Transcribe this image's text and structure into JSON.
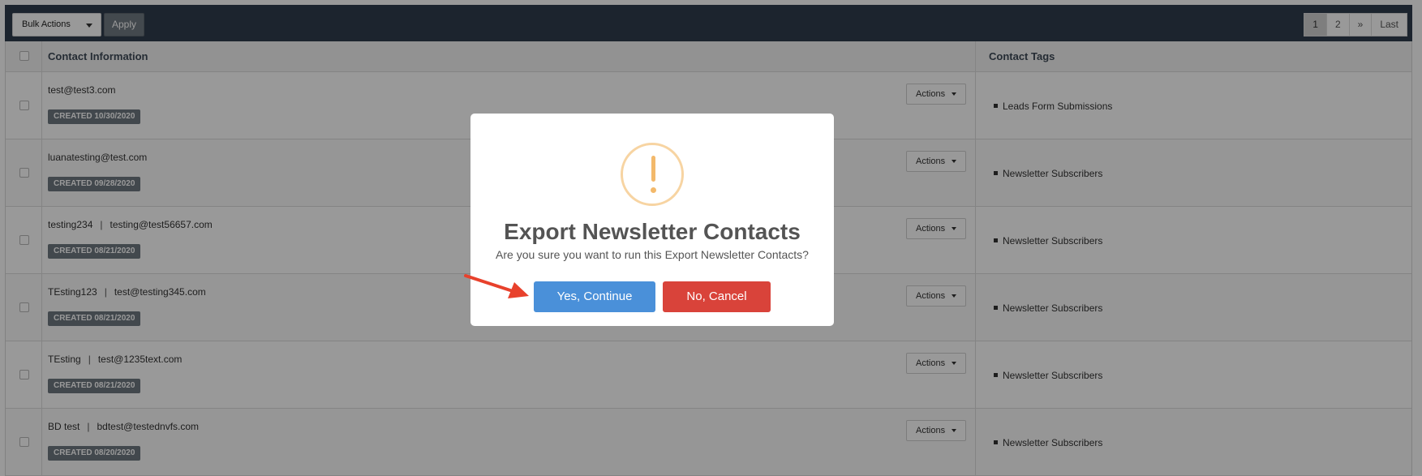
{
  "toolbar": {
    "bulk_actions_label": "Bulk Actions",
    "apply_label": "Apply",
    "pagination": [
      "1",
      "2",
      "»",
      "Last"
    ],
    "active_page": "1"
  },
  "table": {
    "headers": {
      "contact_information": "Contact Information",
      "contact_tags": "Contact Tags"
    },
    "actions_label": "Actions",
    "rows": [
      {
        "name": "",
        "email": "test@test3.com",
        "created": "CREATED 10/30/2020",
        "tag": "Leads Form Submissions"
      },
      {
        "name": "",
        "email": "luanatesting@test.com",
        "created": "CREATED 09/28/2020",
        "tag": "Newsletter Subscribers"
      },
      {
        "name": "testing234",
        "email": "testing@test56657.com",
        "created": "CREATED 08/21/2020",
        "tag": "Newsletter Subscribers"
      },
      {
        "name": "TEsting123",
        "email": "test@testing345.com",
        "created": "CREATED 08/21/2020",
        "tag": "Newsletter Subscribers"
      },
      {
        "name": "TEsting",
        "email": "test@1235text.com",
        "created": "CREATED 08/21/2020",
        "tag": "Newsletter Subscribers"
      },
      {
        "name": "BD test",
        "email": "bdtest@testednvfs.com",
        "created": "CREATED 08/20/2020",
        "tag": "Newsletter Subscribers"
      }
    ]
  },
  "modal": {
    "icon": "warning-icon",
    "title": "Export Newsletter Contacts",
    "text": "Are you sure you want to run this Export Newsletter Contacts?",
    "confirm_label": "Yes, Continue",
    "cancel_label": "No, Cancel"
  },
  "colors": {
    "toolbar_bg": "#2f3d4d",
    "confirm": "#4a90d9",
    "cancel": "#d9433a",
    "warning": "#f3b96b",
    "annotation_arrow": "#e8412c"
  }
}
